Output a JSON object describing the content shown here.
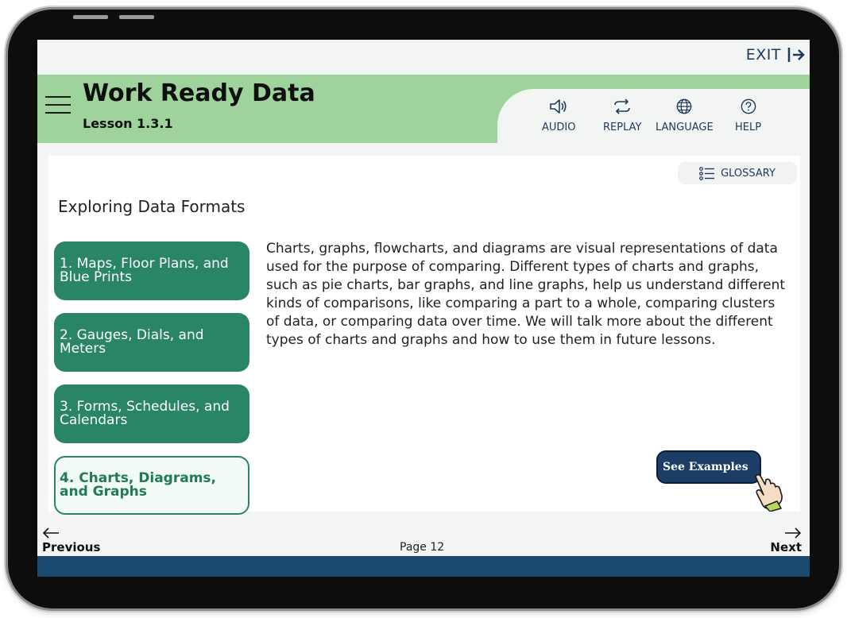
{
  "exit_label": "EXIT",
  "header": {
    "title": "Work Ready Data",
    "lesson": "Lesson 1.3.1"
  },
  "toolbar": {
    "audio": "AUDIO",
    "replay": "REPLAY",
    "language": "LANGUAGE",
    "help": "HELP"
  },
  "glossary_label": "GLOSSARY",
  "section_title": "Exploring Data Formats",
  "topics": [
    {
      "label": "1. Maps, Floor Plans, and Blue Prints"
    },
    {
      "label": "2. Gauges, Dials, and Meters"
    },
    {
      "label": "3. Forms, Schedules, and Calendars"
    },
    {
      "label": "4. Charts, Diagrams, and Graphs",
      "active": true
    }
  ],
  "body_text": "Charts, graphs, flowcharts, and diagrams are visual representations of data used for the purpose of comparing. Different types of charts and graphs, such as pie charts, bar graphs, and line graphs, help us understand different kinds of comparisons, like comparing a part to a whole, comparing clusters of data, or comparing data over time. We will talk more about the different types of charts and graphs and how to use them in future lessons.",
  "see_examples_label": "See Examples",
  "footer": {
    "previous": "Previous",
    "page": "Page 12",
    "next": "Next"
  },
  "colors": {
    "header_green": "#9ed39c",
    "button_green": "#2a8565",
    "navy": "#1c3a5c",
    "bottom_bar": "#1c4a6e"
  },
  "icons": [
    "menu-icon",
    "exit-icon",
    "speaker-icon",
    "replay-icon",
    "globe-icon",
    "help-icon",
    "list-icon",
    "pointer-hand-icon",
    "arrow-left-icon",
    "arrow-right-icon"
  ]
}
